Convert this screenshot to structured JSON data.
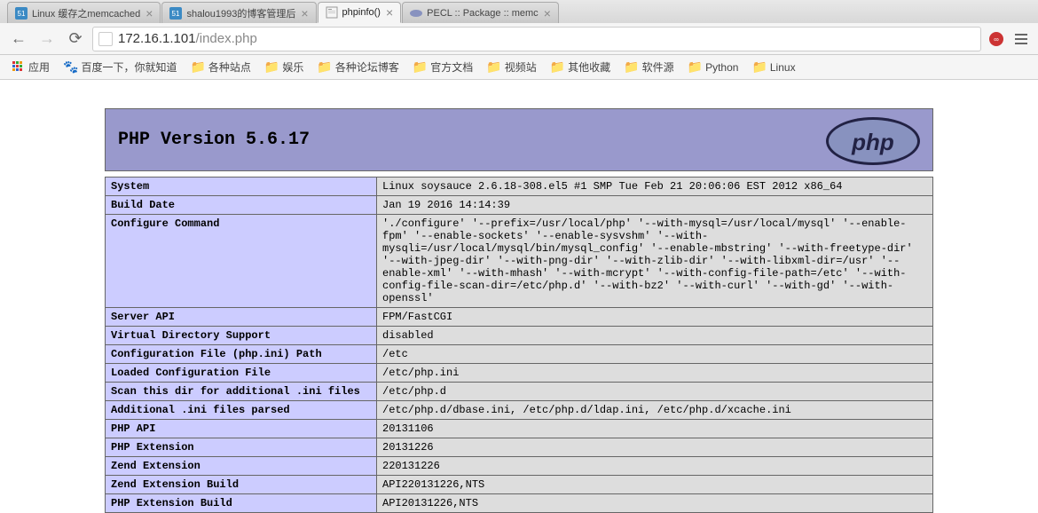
{
  "browser": {
    "tabs": [
      {
        "title": "Linux 缓存之memcached",
        "active": false,
        "icon": "51cto"
      },
      {
        "title": "shalou1993的博客管理后",
        "active": false,
        "icon": "51cto"
      },
      {
        "title": "phpinfo()",
        "active": true,
        "icon": "page"
      },
      {
        "title": "PECL :: Package :: memc",
        "active": false,
        "icon": "pecl"
      }
    ],
    "url_host": "172.16.1.101",
    "url_path": "/index.php"
  },
  "bookmarks": {
    "apps_label": "应用",
    "baidu_label": "百度一下，你就知道",
    "folders": [
      "各种站点",
      "娱乐",
      "各种论坛博客",
      "官方文档",
      "视频站",
      "其他收藏",
      "软件源",
      "Python",
      "Linux"
    ]
  },
  "phpinfo": {
    "version_label": "PHP Version 5.6.17",
    "rows": [
      {
        "k": "System",
        "v": "Linux soysauce 2.6.18-308.el5 #1 SMP Tue Feb 21 20:06:06 EST 2012 x86_64"
      },
      {
        "k": "Build Date",
        "v": "Jan 19 2016 14:14:39"
      },
      {
        "k": "Configure Command",
        "v": "'./configure' '--prefix=/usr/local/php' '--with-mysql=/usr/local/mysql' '--enable-fpm' '--enable-sockets' '--enable-sysvshm' '--with-mysqli=/usr/local/mysql/bin/mysql_config' '--enable-mbstring' '--with-freetype-dir' '--with-jpeg-dir' '--with-png-dir' '--with-zlib-dir' '--with-libxml-dir=/usr' '--enable-xml' '--with-mhash' '--with-mcrypt' '--with-config-file-path=/etc' '--with-config-file-scan-dir=/etc/php.d' '--with-bz2' '--with-curl' '--with-gd' '--with-openssl'"
      },
      {
        "k": "Server API",
        "v": "FPM/FastCGI"
      },
      {
        "k": "Virtual Directory Support",
        "v": "disabled"
      },
      {
        "k": "Configuration File (php.ini) Path",
        "v": "/etc"
      },
      {
        "k": "Loaded Configuration File",
        "v": "/etc/php.ini"
      },
      {
        "k": "Scan this dir for additional .ini files",
        "v": "/etc/php.d"
      },
      {
        "k": "Additional .ini files parsed",
        "v": "/etc/php.d/dbase.ini, /etc/php.d/ldap.ini, /etc/php.d/xcache.ini"
      },
      {
        "k": "PHP API",
        "v": "20131106"
      },
      {
        "k": "PHP Extension",
        "v": "20131226"
      },
      {
        "k": "Zend Extension",
        "v": "220131226"
      },
      {
        "k": "Zend Extension Build",
        "v": "API220131226,NTS"
      },
      {
        "k": "PHP Extension Build",
        "v": "API20131226,NTS"
      }
    ]
  }
}
